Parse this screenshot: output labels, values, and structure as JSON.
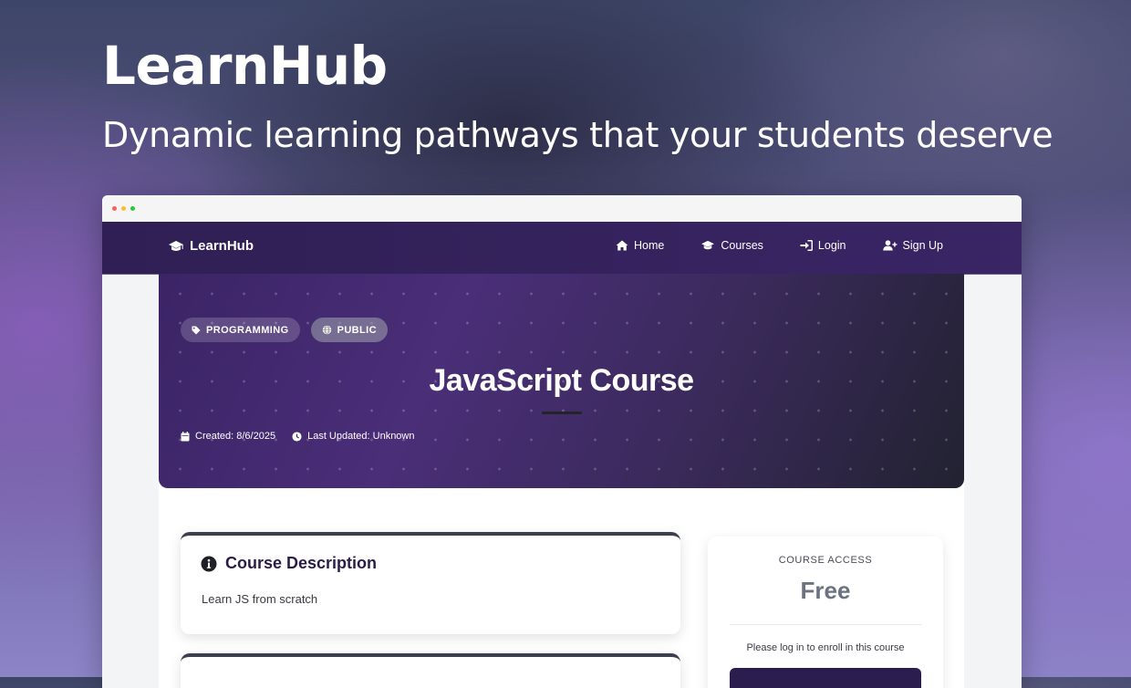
{
  "hero": {
    "title": "LearnHub",
    "subtitle": "Dynamic learning pathways that your students deserve"
  },
  "navbar": {
    "brand": "LearnHub",
    "brand_icon": "graduation-cap-icon",
    "links": [
      {
        "label": "Home",
        "icon": "home-icon"
      },
      {
        "label": "Courses",
        "icon": "graduation-cap-icon"
      },
      {
        "label": "Login",
        "icon": "sign-in-icon"
      },
      {
        "label": "Sign Up",
        "icon": "user-plus-icon"
      }
    ]
  },
  "course": {
    "category": "PROGRAMMING",
    "visibility": "PUBLIC",
    "title": "JavaScript Course",
    "created": "Created: 8/6/2025",
    "updated": "Last Updated: Unknown"
  },
  "description": {
    "heading": "Course Description",
    "text": "Learn JS from scratch"
  },
  "access": {
    "label": "COURSE ACCESS",
    "price": "Free",
    "note": "Please log in to enroll in this course"
  },
  "colors": {
    "nav_bg": "#2f1f54",
    "banner_start": "#3b2466",
    "banner_end": "#222231",
    "primary_button": "#2b1d4d"
  }
}
